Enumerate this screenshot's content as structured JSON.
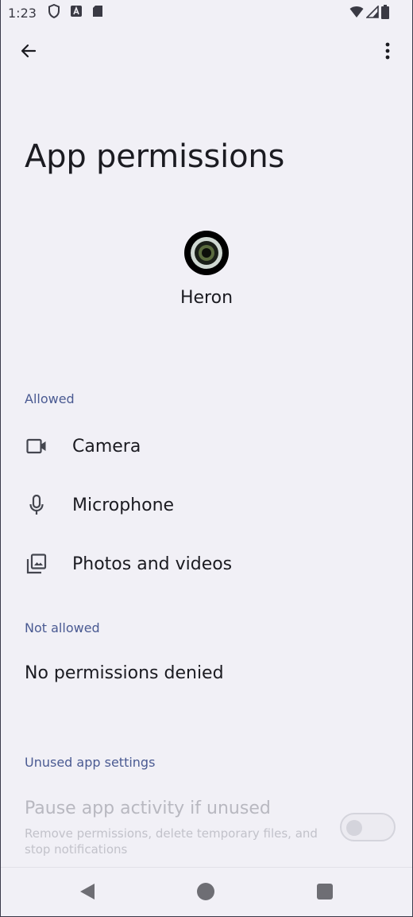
{
  "status_bar": {
    "time": "1:23",
    "icons": [
      "shield-icon",
      "a-icon",
      "sd-card-icon",
      "wifi-icon",
      "signal-icon",
      "battery-icon"
    ]
  },
  "app_bar": {
    "back_icon": "arrow-back-icon",
    "more_icon": "more-vert-icon"
  },
  "page": {
    "title": "App permissions",
    "app_name": "Heron"
  },
  "sections": {
    "allowed": {
      "header": "Allowed",
      "items": [
        {
          "label": "Camera",
          "icon": "camera-icon"
        },
        {
          "label": "Microphone",
          "icon": "microphone-icon"
        },
        {
          "label": "Photos and videos",
          "icon": "photos-icon"
        }
      ]
    },
    "not_allowed": {
      "header": "Not allowed",
      "empty_text": "No permissions denied"
    },
    "unused": {
      "header": "Unused app settings",
      "pause_title": "Pause app activity if unused",
      "pause_subtitle": "Remove permissions, delete temporary files, and stop notifications",
      "toggle_on": false
    }
  },
  "colors": {
    "background": "#f1f0f6",
    "section_header": "#4a5a92",
    "text_primary": "#1b1b21",
    "text_disabled": "#b8b8c0"
  }
}
